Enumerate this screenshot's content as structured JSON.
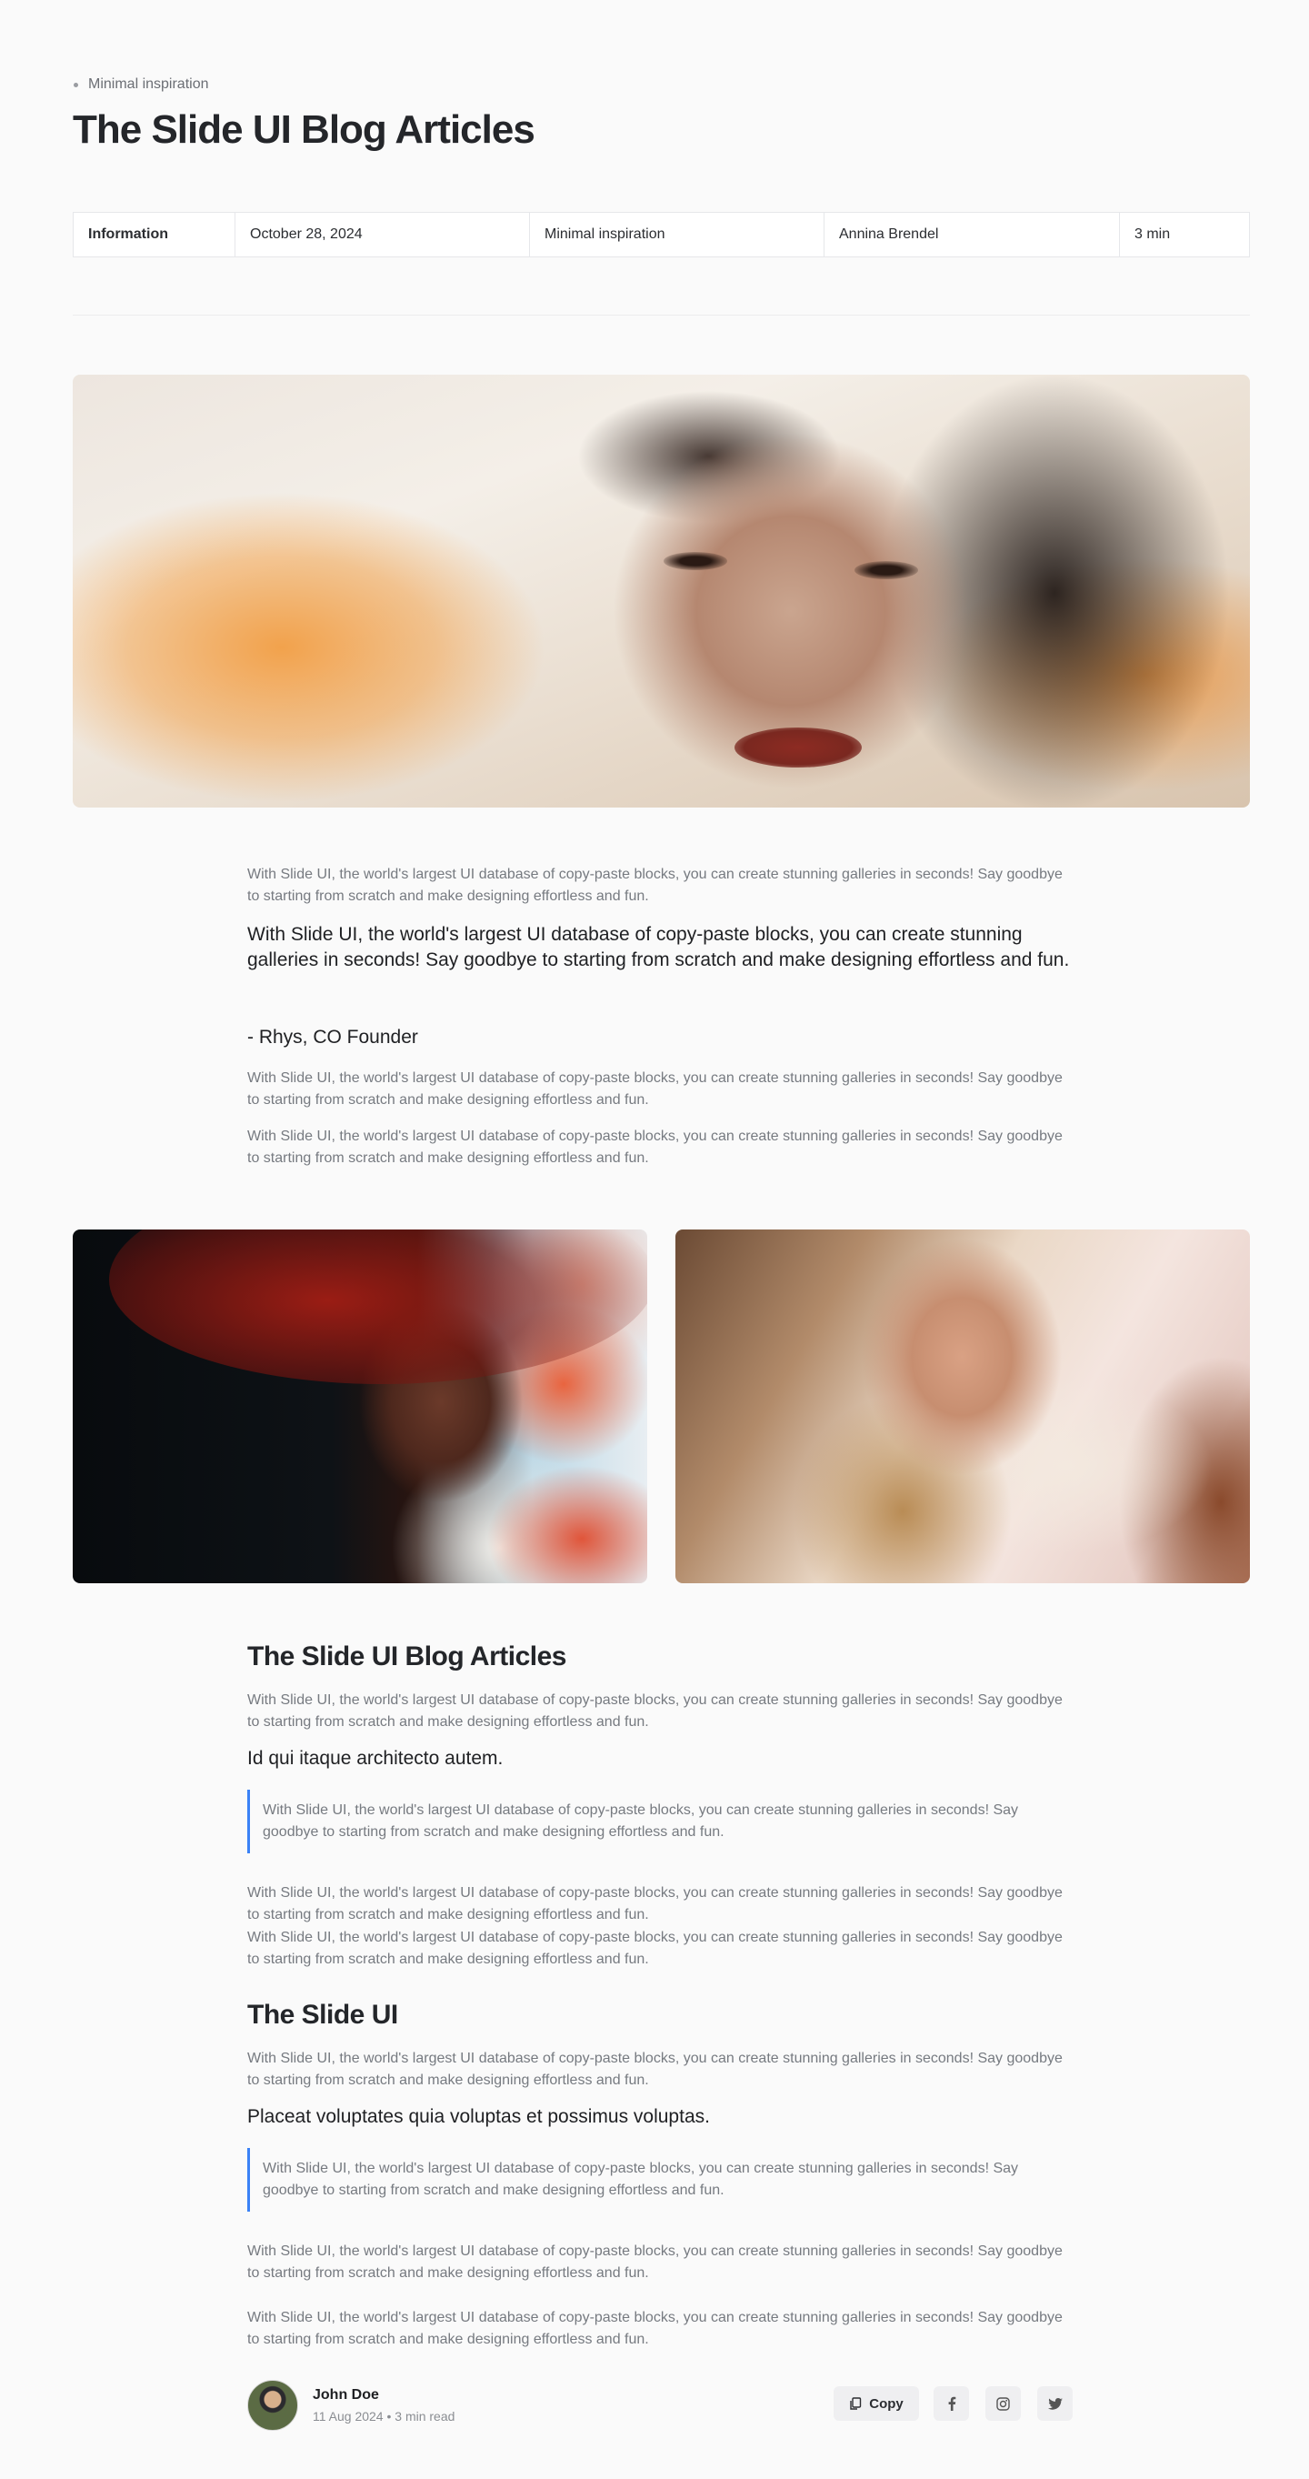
{
  "header": {
    "breadcrumb": "Minimal inspiration",
    "title": "The Slide UI Blog Articles"
  },
  "info_table": {
    "label": "Information",
    "date": "October 28, 2024",
    "category": "Minimal inspiration",
    "author": "Annina Brendel",
    "read_time": "3 min"
  },
  "article": {
    "intro_paragraph": "With Slide UI, the world's largest UI database of copy-paste blocks, you can create stunning galleries in seconds! Say goodbye to starting from scratch and make designing effortless and fun.",
    "pull_quote": "With Slide UI, the world's largest UI database of copy-paste blocks, you can create stunning galleries in seconds! Say goodbye to starting from scratch and make designing effortless and fun.",
    "quote_attribution": "- Rhys, CO Founder",
    "paragraph_2": "With Slide UI, the world's largest UI database of copy-paste blocks, you can create stunning galleries in seconds! Say goodbye to starting from scratch and make designing effortless and fun.",
    "paragraph_3": "With Slide UI, the world's largest UI database of copy-paste blocks, you can create stunning galleries in seconds! Say goodbye to starting from scratch and make designing effortless and fun.",
    "section1": {
      "heading": "The Slide UI Blog Articles",
      "paragraph": "With Slide UI, the world's largest UI database of copy-paste blocks, you can create stunning galleries in seconds! Say goodbye to starting from scratch and make designing effortless and fun.",
      "subheading": "Id qui itaque architecto autem.",
      "blockquote": "With Slide UI, the world's largest UI database of copy-paste blocks, you can create stunning galleries in seconds! Say goodbye to starting from scratch and make designing effortless and fun.",
      "paragraph_a": "With Slide UI, the world's largest UI database of copy-paste blocks, you can create stunning galleries in seconds! Say goodbye to starting from scratch and make designing effortless and fun.",
      "paragraph_b": "With Slide UI, the world's largest UI database of copy-paste blocks, you can create stunning galleries in seconds! Say goodbye to starting from scratch and make designing effortless and fun."
    },
    "section2": {
      "heading": "The Slide UI",
      "paragraph": "With Slide UI, the world's largest UI database of copy-paste blocks, you can create stunning galleries in seconds! Say goodbye to starting from scratch and make designing effortless and fun.",
      "subheading": "Placeat voluptates quia voluptas et possimus voluptas.",
      "blockquote": "With Slide UI, the world's largest UI database of copy-paste blocks, you can create stunning galleries in seconds! Say goodbye to starting from scratch and make designing effortless and fun.",
      "paragraph_a": "With Slide UI, the world's largest UI database of copy-paste blocks, you can create stunning galleries in seconds! Say goodbye to starting from scratch and make designing effortless and fun.",
      "paragraph_b": "With Slide UI, the world's largest UI database of copy-paste blocks, you can create stunning galleries in seconds! Say goodbye to starting from scratch and make designing effortless and fun."
    }
  },
  "footer": {
    "author_name": "John Doe",
    "author_meta": "11 Aug 2024 • 3 min read",
    "copy_label": "Copy",
    "icons": [
      "copy-icon",
      "facebook-icon",
      "instagram-icon",
      "twitter-icon"
    ]
  },
  "colors": {
    "accent_blue": "#3b82f6",
    "background": "#fafafa",
    "muted_text": "#767a80"
  }
}
